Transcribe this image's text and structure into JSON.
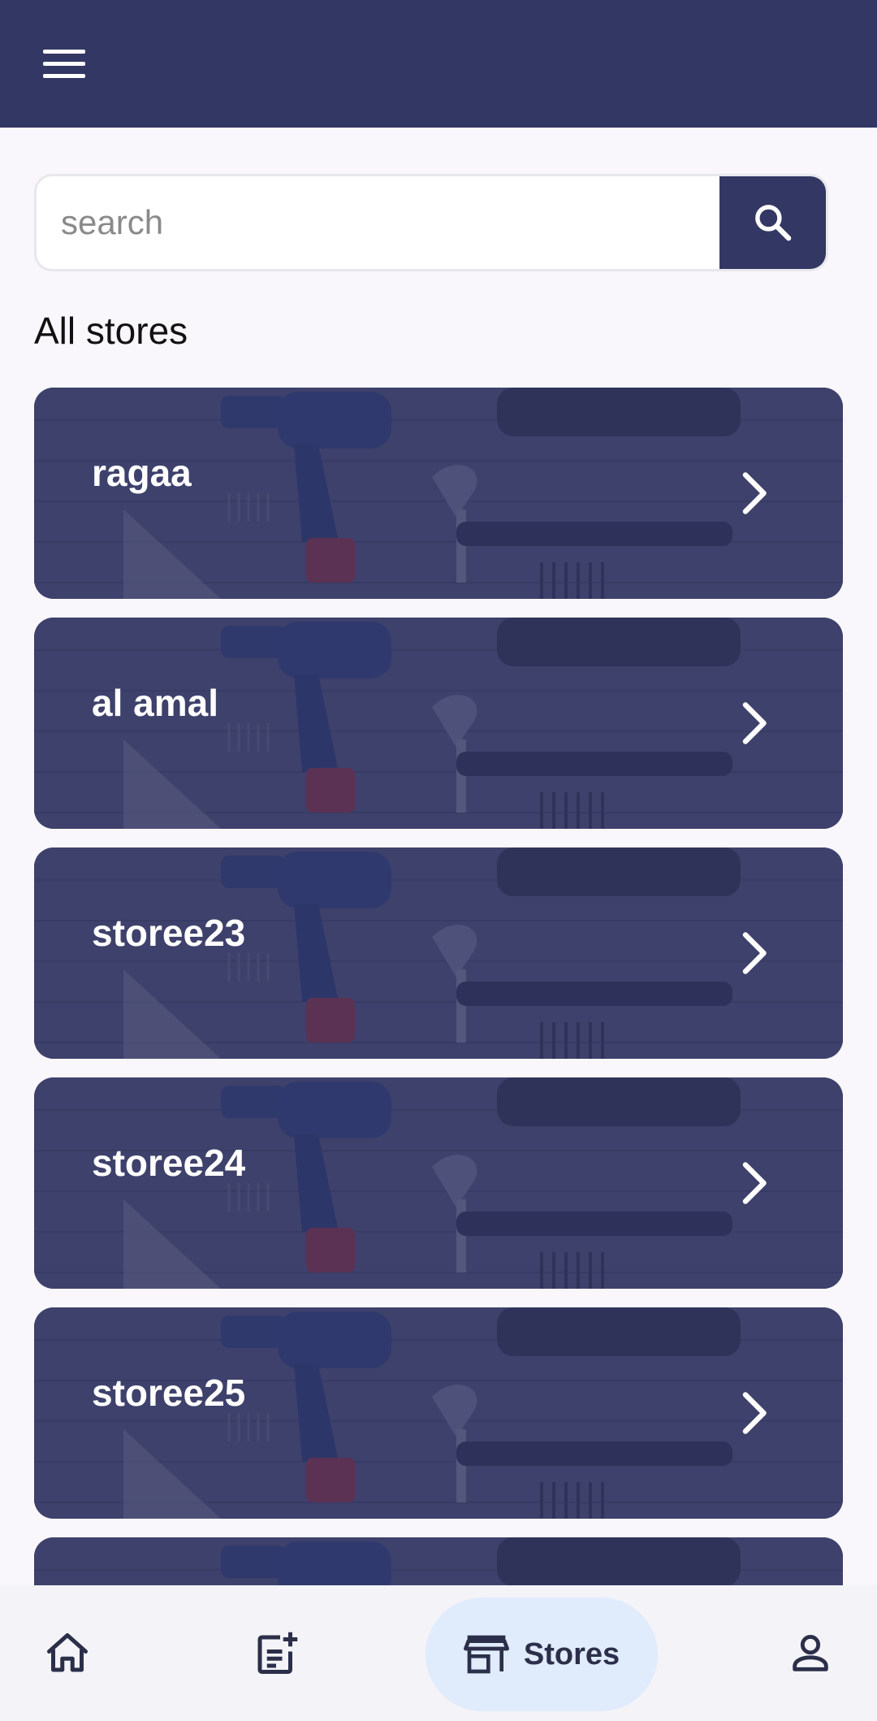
{
  "app_bar": {
    "menu_icon": "menu-icon"
  },
  "search": {
    "placeholder": "search",
    "value": "",
    "button_icon": "search-icon"
  },
  "section_title": "All stores",
  "stores": [
    {
      "name": "ragaa"
    },
    {
      "name": "al amal"
    },
    {
      "name": "storee23"
    },
    {
      "name": "storee24"
    },
    {
      "name": "storee25"
    },
    {
      "name": ""
    }
  ],
  "bottom_nav": {
    "items": [
      {
        "icon": "home-icon",
        "label": ""
      },
      {
        "icon": "add-post-icon",
        "label": ""
      },
      {
        "icon": "store-icon",
        "label": "Stores",
        "selected": true
      },
      {
        "icon": "person-icon",
        "label": ""
      }
    ]
  },
  "colors": {
    "primary": "#323763",
    "background": "#f9f7fb",
    "nav_pill": "#e0ebfb"
  }
}
